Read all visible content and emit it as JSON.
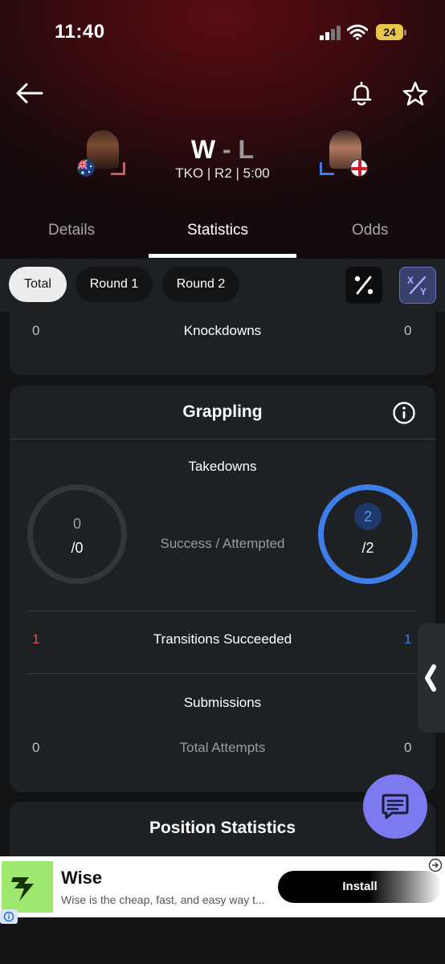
{
  "status": {
    "time": "11:40",
    "battery": "24"
  },
  "match": {
    "result_win": "W",
    "result_sep": "-",
    "result_loss": "L",
    "method": "TKO | R2 | 5:00"
  },
  "tabs": [
    {
      "label": "Details"
    },
    {
      "label": "Statistics"
    },
    {
      "label": "Odds"
    }
  ],
  "filters": [
    {
      "label": "Total"
    },
    {
      "label": "Round 1"
    },
    {
      "label": "Round 2"
    }
  ],
  "knockdowns": {
    "left": "0",
    "label": "Knockdowns",
    "right": "0"
  },
  "grappling": {
    "title": "Grappling",
    "takedowns": {
      "label": "Takedowns",
      "left_success": "0",
      "left_attempted": "/0",
      "center_label": "Success / Attempted",
      "right_success": "2",
      "right_attempted": "/2",
      "left_fraction": 0,
      "right_fraction": 1
    },
    "transitions": {
      "left": "1",
      "label": "Transitions Succeeded",
      "right": "1"
    },
    "submissions": {
      "label": "Submissions",
      "left": "0",
      "sub_label": "Total Attempts",
      "right": "0"
    }
  },
  "position": {
    "title": "Position Statistics"
  },
  "ad": {
    "title": "Wise",
    "description": "Wise is the cheap, fast, and easy way t...",
    "button": "Install"
  },
  "colors": {
    "red_corner": "#e14d5a",
    "blue_corner": "#3d7ee8",
    "fab": "#7d79ee",
    "ad_logo": "#9fe870"
  }
}
